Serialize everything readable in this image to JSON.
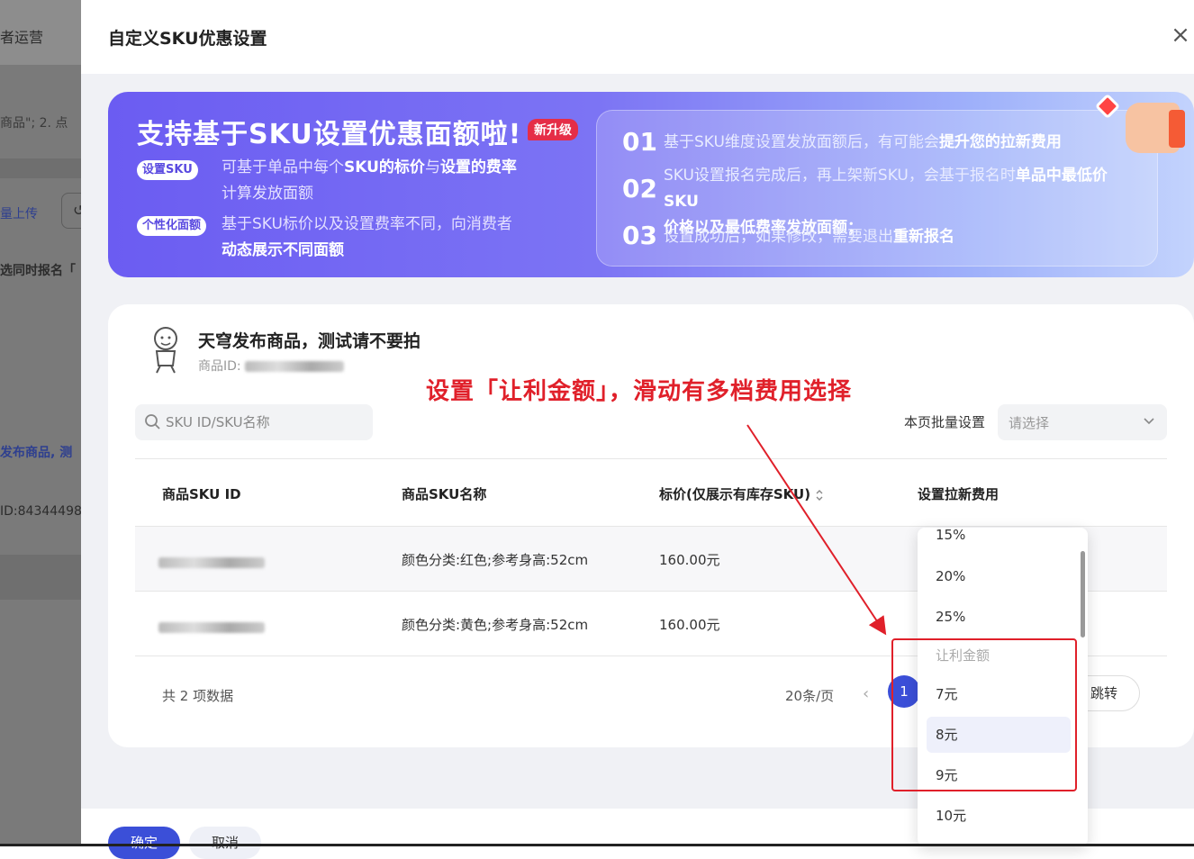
{
  "background": {
    "nav_title": "者运营",
    "hint_text": "商品\"; 2. 点",
    "upload_label": "量上传",
    "upload_icon_char": "↺",
    "same_time_text": "选同时报名「",
    "product_partial": "发布商品, 测",
    "id_partial": "ID:84344498"
  },
  "drawer": {
    "title": "自定义SKU优惠设置",
    "close_icon": "×"
  },
  "banner": {
    "title": "支持基于SKU设置优惠面额啦!",
    "badge": "新升级",
    "pill1": "设置SKU",
    "desc1_a": "可基于单品中每个",
    "desc1_b": "SKU的标价",
    "desc1_c": "与",
    "desc1_d": "设置的费率",
    "desc1_e": "计算发放面额",
    "pill2": "个性化面额",
    "desc2_a": "基于SKU标价以及设置费率不同，向消费者",
    "desc2_b": "动态展示不同面额",
    "items": [
      {
        "num": "01",
        "text_a": "基于SKU维度设置发放面额后，有可能会",
        "text_b": "提升您的拉新费用"
      },
      {
        "num": "02",
        "text_a": "SKU设置报名完成后，再上架新SKU，会基于报名时",
        "text_b": "单品中最低价SKU",
        "text_c": "价格以及最低费率发放面额；"
      },
      {
        "num": "03",
        "text_a": "设置成功后，如果修改，需要退出",
        "text_b": "重新报名"
      }
    ]
  },
  "product": {
    "name": "天穹发布商品，测试请不要拍",
    "id_label": "商品ID:"
  },
  "search": {
    "placeholder": "SKU ID/SKU名称"
  },
  "batch": {
    "label": "本页批量设置",
    "placeholder": "请选择"
  },
  "table": {
    "headers": [
      "商品SKU ID",
      "商品SKU名称",
      "标价(仅展示有库存SKU)",
      "设置拉新费用"
    ],
    "rows": [
      {
        "name": "颜色分类:红色;参考身高:52cm",
        "price": "160.00元"
      },
      {
        "name": "颜色分类:黄色;参考身高:52cm",
        "price": "160.00元"
      }
    ]
  },
  "pagination": {
    "total": "共 2 项数据",
    "per_page": "20条/页",
    "prev": "‹",
    "current": "1",
    "jump": "跳转"
  },
  "footer": {
    "ok": "确定",
    "cancel": "取消"
  },
  "dropdown": {
    "options": [
      "15%",
      "20%",
      "25%"
    ],
    "group_label": "让利金额",
    "amounts": [
      "7元",
      "8元",
      "9元",
      "10元"
    ],
    "active": "8元"
  },
  "annotation": {
    "text": "设置「让利金额」，滑动有多档费用选择",
    "color": "#e0202a"
  }
}
